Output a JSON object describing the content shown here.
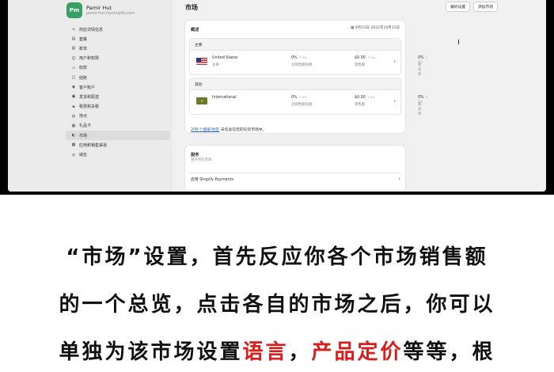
{
  "store": {
    "avatar": "Pm",
    "name": "Pamir Hut",
    "url": "pamir-hut.myshopify.com"
  },
  "nav": [
    {
      "icon": "house-icon",
      "label": "商店详情信息"
    },
    {
      "icon": "plan-icon",
      "label": "套餐"
    },
    {
      "icon": "billing-icon",
      "label": "账单"
    },
    {
      "icon": "users-icon",
      "label": "用户和权限"
    },
    {
      "icon": "payments-icon",
      "label": "收款"
    },
    {
      "icon": "checkout-icon",
      "label": "结账"
    },
    {
      "icon": "customers-icon",
      "label": "客户账户"
    },
    {
      "icon": "shipping-icon",
      "label": "发货和配送"
    },
    {
      "icon": "tax-icon",
      "label": "税费和关税"
    },
    {
      "icon": "location-icon",
      "label": "地点"
    },
    {
      "icon": "gift-icon",
      "label": "礼品卡"
    },
    {
      "icon": "globe-icon",
      "label": "市场",
      "active": true
    },
    {
      "icon": "apps-icon",
      "label": "应用和销售渠道"
    },
    {
      "icon": "domain-icon",
      "label": "域名"
    }
  ],
  "page": {
    "title": "市场",
    "btn1": "偏好设置",
    "btn2": "添加市场"
  },
  "overview": {
    "title": "概述",
    "daterange": "9月15日–2022年10月15日",
    "primary_label": "主要",
    "other_label": "其他",
    "markets": [
      {
        "name": "United States",
        "tag": "主要",
        "stats": [
          {
            "value": "0%",
            "change": "0%",
            "label": "总销售额份额"
          },
          {
            "value": "$0.00",
            "change": "0%",
            "label": "销售额"
          },
          {
            "value": "0%",
            "change": "0%",
            "label": "转化率"
          }
        ]
      },
      {
        "name": "International",
        "tag": "",
        "stats": [
          {
            "value": "0%",
            "change": "0%",
            "label": "总销售额份额"
          },
          {
            "value": "$0.00",
            "change": "0%",
            "label": "销售额"
          },
          {
            "value": "0%",
            "change": "0%",
            "label": "转化率"
          }
        ]
      }
    ],
    "link_text": "208 个国家/地区",
    "link_suffix": "未包含在您的任何市场中。"
  },
  "card2": {
    "title": "服务",
    "subtitle": "基于所在市场",
    "item": "启用 Shopify Payments"
  },
  "caption": {
    "line1": "“市场”设置，首先反应你各个市场销售额",
    "line2": "的一个总览，点击各自的市场之后，你可以",
    "line3a": "单独为该市场设置",
    "line3b": "语言",
    "line3c": "，",
    "line3d": "产品定价",
    "line3e": "等等，根"
  },
  "colors": {
    "accent_red": "#d91c1c",
    "avatar_green": "#36a163",
    "link_blue": "#2463bd"
  }
}
